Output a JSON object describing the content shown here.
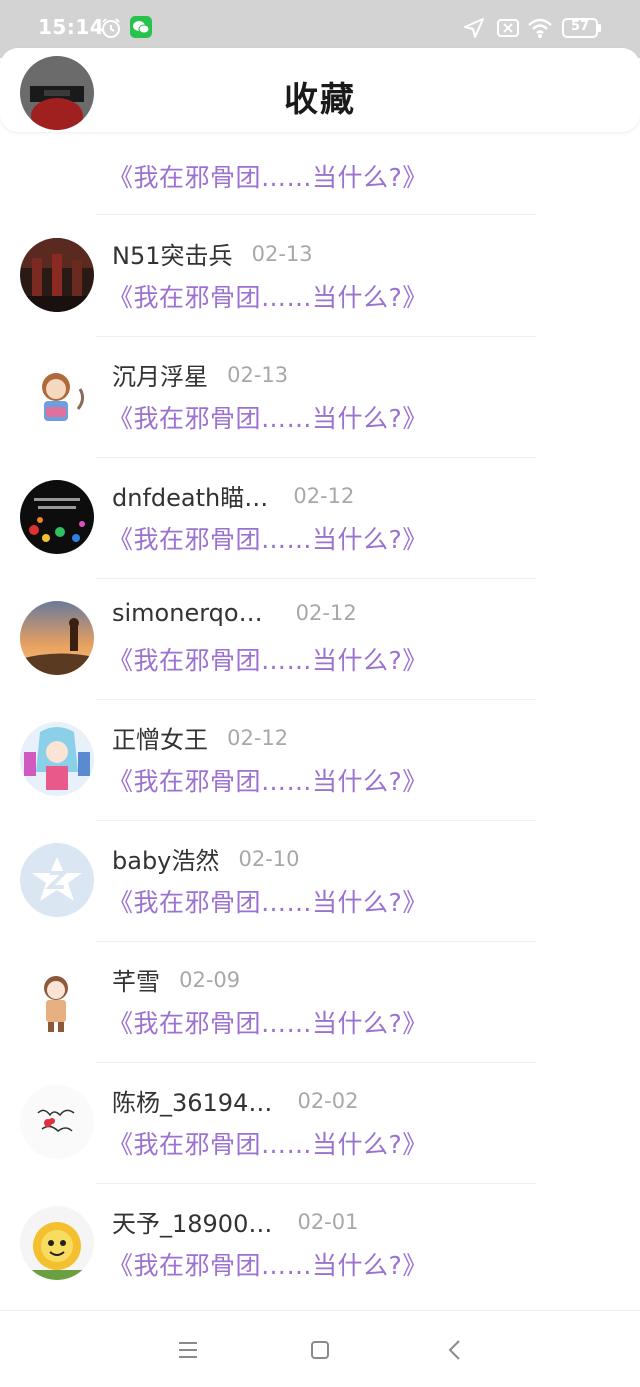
{
  "status_bar": {
    "time": "15:14",
    "battery": "57",
    "icons": [
      "alarm-icon",
      "wechat-icon",
      "location-icon",
      "sim-off-icon",
      "wifi-icon",
      "battery-icon"
    ]
  },
  "header": {
    "title": "收藏",
    "back_icon": "back-arrow-icon"
  },
  "items": [
    {
      "name": "",
      "date": "",
      "book": "《我在邪骨团……当什么?》"
    },
    {
      "name": "N51突击兵",
      "date": "02-13",
      "book": "《我在邪骨团……当什么?》"
    },
    {
      "name": "沉月浮星",
      "date": "02-13",
      "book": "《我在邪骨团……当什么?》"
    },
    {
      "name": "dnfdeath瞄…",
      "date": "02-12",
      "book": "《我在邪骨团……当什么?》"
    },
    {
      "name": "simonerqo…",
      "date": "02-12",
      "book": "《我在邪骨团……当什么?》"
    },
    {
      "name": "正憎女王",
      "date": "02-12",
      "book": "《我在邪骨团……当什么?》"
    },
    {
      "name": "baby浩然",
      "date": "02-10",
      "book": "《我在邪骨团……当什么?》"
    },
    {
      "name": "芊雪",
      "date": "02-09",
      "book": "《我在邪骨团……当什么?》"
    },
    {
      "name": "陈杨_36194…",
      "date": "02-02",
      "book": "《我在邪骨团……当什么?》"
    },
    {
      "name": "天予_18900…",
      "date": "02-01",
      "book": "《我在邪骨团……当什么?》"
    }
  ],
  "nav_bar": {
    "icons": [
      "menu-icon",
      "home-icon",
      "back-icon"
    ]
  },
  "colors": {
    "accent": "#1e88e5",
    "book_title": "#9b72d0",
    "status_bar": "#d3d3d3"
  }
}
